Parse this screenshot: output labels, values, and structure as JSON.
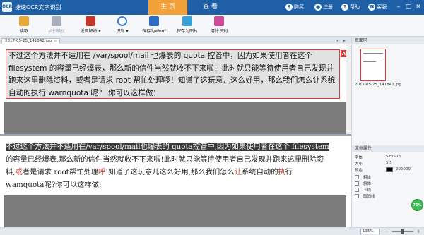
{
  "app": {
    "logo": "OCR",
    "title": "捷速OCR文字识别"
  },
  "top_tabs": [
    {
      "label": "主 页",
      "active": true
    },
    {
      "label": "查 看",
      "active": false
    }
  ],
  "header_actions": {
    "buy": "购买",
    "register": "注册",
    "help": "帮助",
    "service": "客服"
  },
  "window_controls": {
    "minimize": "–",
    "maximize": "□",
    "close": "✕"
  },
  "toolbar": [
    {
      "label": "读取",
      "icon": "folder-open-icon",
      "color": "#e8a73a",
      "enabled": true
    },
    {
      "label": "从扫描仪",
      "icon": "scanner-icon",
      "color": "#a7b0ba",
      "enabled": false
    },
    {
      "label": "纸面解析 ▾",
      "icon": "page-analysis-icon",
      "color": "#c0392b",
      "enabled": true
    },
    {
      "label": "识别 ▾",
      "icon": "magnify-icon",
      "color": "#3a7bd5",
      "enabled": true
    },
    {
      "label": "保存为Word",
      "icon": "word-icon",
      "color": "#2b6cc4",
      "enabled": true
    },
    {
      "label": "保存为图片",
      "icon": "picture-icon",
      "color": "#3aa0d8",
      "enabled": true
    },
    {
      "label": "清除识别",
      "icon": "clear-icon",
      "color": "#d24a9a",
      "enabled": true
    }
  ],
  "document_tab": {
    "name": "2017-05-25_141842.jpg",
    "close": "x"
  },
  "image_pane": {
    "selection_marker": "A",
    "text": "不过这个方法并不适用在 /var/spool/mail 也爆表的 quota 控管中，因为如果使用者在这个 filesystem 的容量已经爆表，那么新的信件当然就收不下来啦！此时就只能等待使用者自己发现并跑来这里删除资料，或者是请求 root 帮忙处理啰！知道了这玩意儿这么好用，那么我们怎么让系统自动的执行 warnquota 呢？ 你可以这样做："
  },
  "result_pane": {
    "line1_highlight": "不过这个方法并不适用在/var/spool/mail也爆表的 quota控管中,因为如果使用者在这个 filesystem",
    "line2": "的容量已经爆表,那么新的信件当然就收不下来啦!此时就只能等待使用者自己发现并跑来这里删除资",
    "line3_a": "料,",
    "line3_red1": "或",
    "line3_b": "者是请求 root帮忙处理",
    "line3_red2": "呼",
    "line3_c": "!知道了这玩意儿这么好用,那么我们怎么",
    "line3_red3": "让",
    "line3_d": "系统自动的",
    "line3_red4": "执",
    "line3_e": "行",
    "line4": "wamquota呢?你可以这样做:"
  },
  "right_panel": {
    "page_area_title": "页面区",
    "thumbnail_name": "2017-05-25_141842.jpg",
    "props_title": "文档属性",
    "font_label": "字体",
    "font_value": "SimSun",
    "size_label": "大小",
    "size_value": "5.5",
    "color_label": "颜色",
    "color_value": "000000",
    "bold_label": "粗体",
    "italic_label": "斜体",
    "underline_label": "下线",
    "strike_label": "取消线",
    "progress": "76%"
  },
  "status": {
    "zoom": "135%",
    "zoom_out": "−",
    "zoom_in": "+"
  }
}
